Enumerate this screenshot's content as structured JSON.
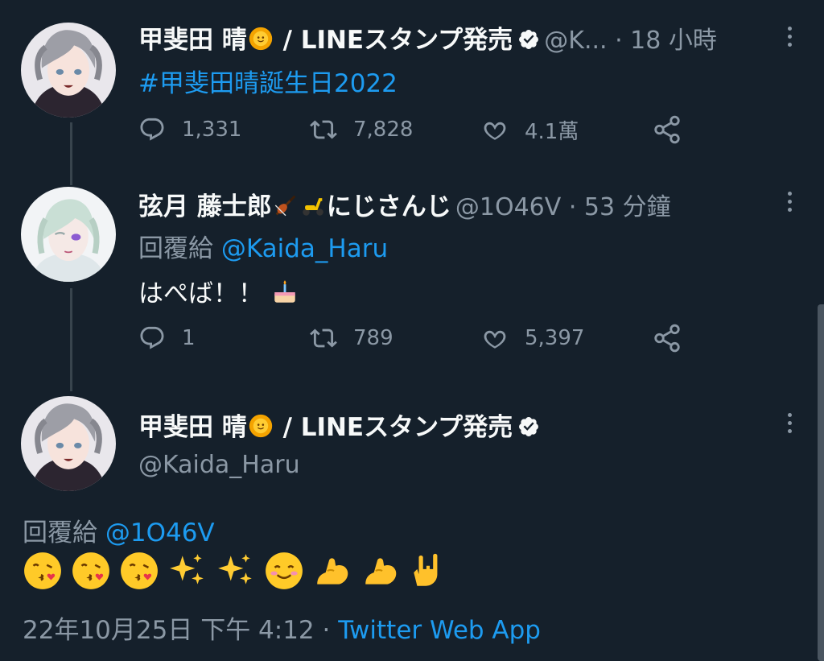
{
  "tweet1": {
    "display_name": "甲斐田 晴",
    "name_suffix": " / LINEスタンプ発売",
    "handle": "@K...",
    "time": " · 18 小時",
    "body": "#甲斐田晴誕生日2022",
    "replies": "1,331",
    "retweets": "7,828",
    "likes": "4.1萬"
  },
  "tweet2": {
    "display_name": "弦月 藤士郎",
    "name_suffix": "にじさんじ",
    "handle": "@1O46V",
    "time": " · 53 分鐘",
    "reply_prefix": "回覆給 ",
    "reply_to": "@Kaida_Haru",
    "body": "はぺば！！",
    "replies": "1",
    "retweets": "789",
    "likes": "5,397"
  },
  "tweet3": {
    "display_name": "甲斐田 晴",
    "name_suffix": " / LINEスタンプ発売",
    "handle": "@Kaida_Haru",
    "reply_prefix": "回覆給 ",
    "reply_to": "@1O46V",
    "timestamp": "22年10月25日 下午 4:12 · ",
    "source": "Twitter Web App"
  },
  "icons": [
    "reply-icon",
    "retweet-icon",
    "like-icon",
    "share-icon",
    "verified-icon",
    "more-icon",
    "sun-emoji",
    "violin-emoji",
    "scooter-emoji",
    "cake-emoji",
    "kiss-emoji",
    "sparkles-emoji",
    "smiling-emoji",
    "flexed-biceps-emoji",
    "rock-on-emoji"
  ],
  "colors": {
    "background": "#15202b",
    "muted": "#8b98a5",
    "link": "#1d9bf0",
    "text": "#f7f9f9"
  }
}
